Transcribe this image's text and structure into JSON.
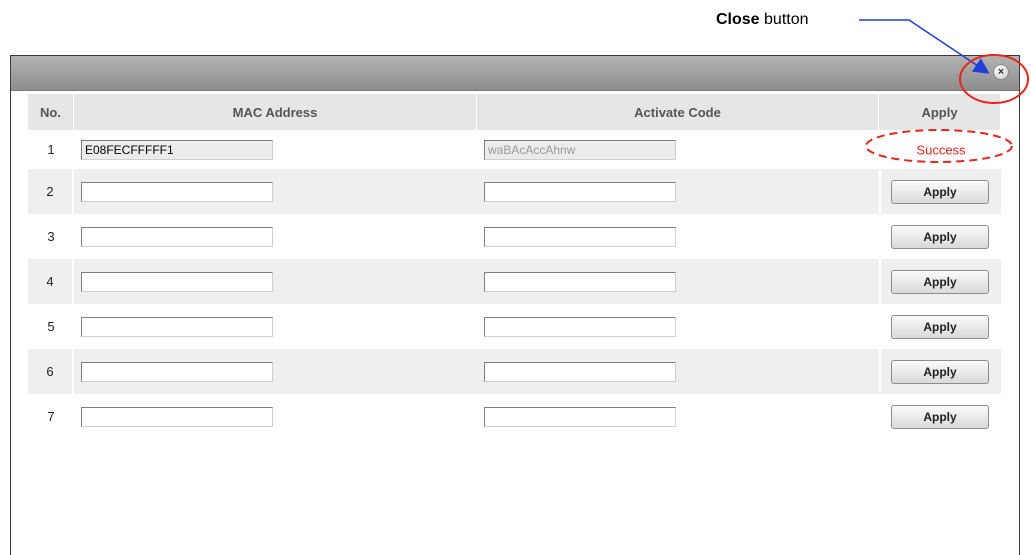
{
  "annotation": {
    "callout_bold": "Close",
    "callout_rest": " button"
  },
  "dialog": {
    "close_glyph": "×",
    "columns": {
      "no": "No.",
      "mac": "MAC Address",
      "code": "Activate Code",
      "apply": "Apply"
    },
    "rows": [
      {
        "no": "1",
        "mac": "E08FECFFFFF1",
        "code": "waBAcAccAhnw",
        "status": "Success"
      },
      {
        "no": "2",
        "mac": "",
        "code": "",
        "apply_label": "Apply"
      },
      {
        "no": "3",
        "mac": "",
        "code": "",
        "apply_label": "Apply"
      },
      {
        "no": "4",
        "mac": "",
        "code": "",
        "apply_label": "Apply"
      },
      {
        "no": "5",
        "mac": "",
        "code": "",
        "apply_label": "Apply"
      },
      {
        "no": "6",
        "mac": "",
        "code": "",
        "apply_label": "Apply"
      },
      {
        "no": "7",
        "mac": "",
        "code": "",
        "apply_label": "Apply"
      }
    ]
  },
  "colors": {
    "success_text": "#e8261a",
    "annotation_red": "#e8261a",
    "annotation_arrow": "#1f3fdc"
  }
}
